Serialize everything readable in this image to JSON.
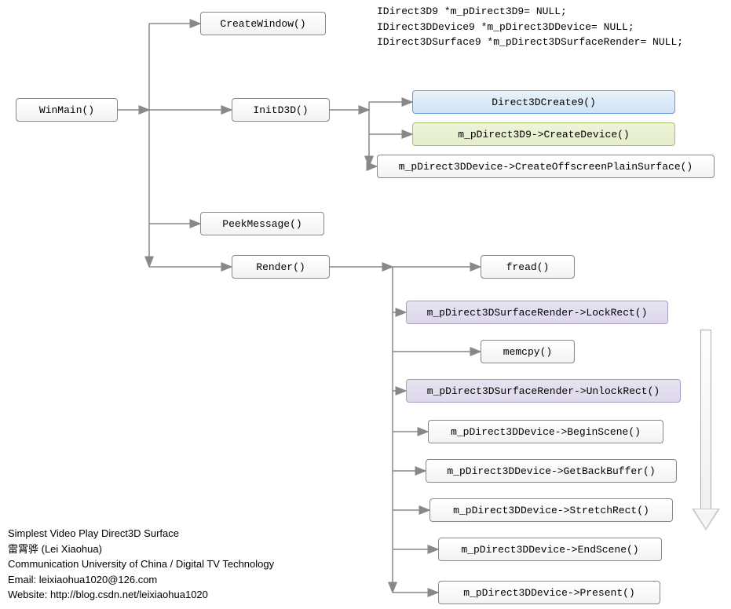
{
  "winmain": "WinMain()",
  "createwindow": "CreateWindow()",
  "initd3d": "InitD3D()",
  "peekmessage": "PeekMessage()",
  "render": "Render()",
  "d3dcreate9": "Direct3DCreate9()",
  "createdevice": "m_pDirect3D9->CreateDevice()",
  "createoffscreen": "m_pDirect3DDevice->CreateOffscreenPlainSurface()",
  "fread": "fread()",
  "lockrect": "m_pDirect3DSurfaceRender->LockRect()",
  "memcpy": "memcpy()",
  "unlockrect": "m_pDirect3DSurfaceRender->UnlockRect()",
  "beginscene": "m_pDirect3DDevice->BeginScene()",
  "getbackbuffer": "m_pDirect3DDevice->GetBackBuffer()",
  "stretchrect": "m_pDirect3DDevice->StretchRect()",
  "endscene": "m_pDirect3DDevice->EndScene()",
  "present": "m_pDirect3DDevice->Present()",
  "codeblock": "IDirect3D9 *m_pDirect3D9= NULL;\nIDirect3DDevice9 *m_pDirect3DDevice= NULL;\nIDirect3DSurface9 *m_pDirect3DSurfaceRender= NULL;",
  "footer": {
    "title": "Simplest Video Play Direct3D Surface",
    "author": "雷霄骅 (Lei Xiaohua)",
    "affil": "Communication University of China / Digital TV Technology",
    "email": "Email:  leixiaohua1020@126.com",
    "website": "Website:  http://blog.csdn.net/leixiaohua1020"
  }
}
